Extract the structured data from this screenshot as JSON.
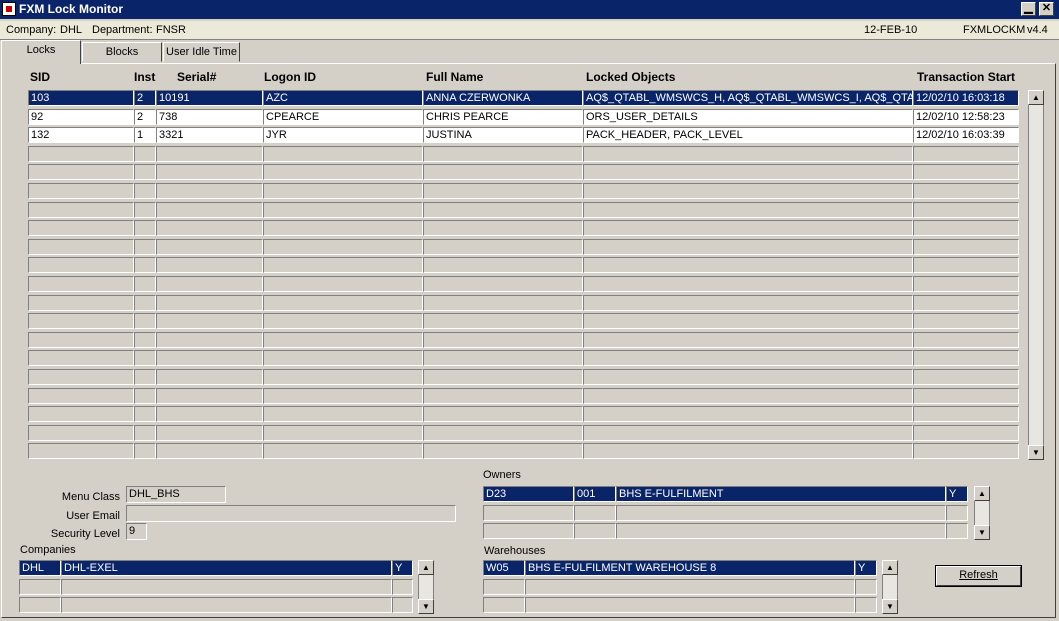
{
  "window": {
    "title": "FXM Lock Monitor",
    "min_glyph": "▁",
    "close_glyph": "✕"
  },
  "info": {
    "company_label": "Company:",
    "company": "DHL",
    "department_label": "Department:",
    "department": "FNSR",
    "date": "12-FEB-10",
    "form": "FXMLOCKM",
    "version": "v4.4"
  },
  "tabs": [
    {
      "label": "Locks"
    },
    {
      "label": "Blocks"
    },
    {
      "label": "User Idle Time"
    }
  ],
  "locks": {
    "columns": [
      "SID",
      "Inst",
      "Serial#",
      "Logon ID",
      "Full Name",
      "Locked Objects",
      "Transaction Start"
    ],
    "rows": [
      [
        "103",
        "2",
        "10191",
        "AZC",
        "ANNA CZERWONKA",
        "AQ$_QTABL_WMSWCS_H, AQ$_QTABL_WMSWCS_I, AQ$_QTAB",
        "12/02/10 16:03:18"
      ],
      [
        "92",
        "2",
        "738",
        "CPEARCE",
        "CHRIS PEARCE",
        "ORS_USER_DETAILS",
        "12/02/10 12:58:23"
      ],
      [
        "132",
        "1",
        "3321",
        "JYR",
        "JUSTINA",
        "PACK_HEADER, PACK_LEVEL",
        "12/02/10 16:03:39"
      ]
    ],
    "total_rows": 20
  },
  "details": {
    "menu_class_label": "Menu Class",
    "menu_class": "DHL_BHS",
    "user_email_label": "User Email",
    "user_email": "",
    "security_level_label": "Security Level",
    "security_level": "9"
  },
  "owners": {
    "label": "Owners",
    "rows": [
      [
        "D23",
        "001",
        "BHS E-FULFILMENT",
        "Y"
      ]
    ],
    "total_rows": 3
  },
  "companies": {
    "label": "Companies",
    "rows": [
      [
        "DHL",
        "DHL-EXEL",
        "Y"
      ]
    ],
    "total_rows": 3
  },
  "warehouses": {
    "label": "Warehouses",
    "rows": [
      [
        "W05",
        "BHS E-FULFILMENT WAREHOUSE 8",
        "Y"
      ]
    ],
    "total_rows": 3
  },
  "refresh": {
    "label": "Refresh"
  },
  "colors": {
    "selection": "#0a246a",
    "face": "#d4d0c8"
  }
}
